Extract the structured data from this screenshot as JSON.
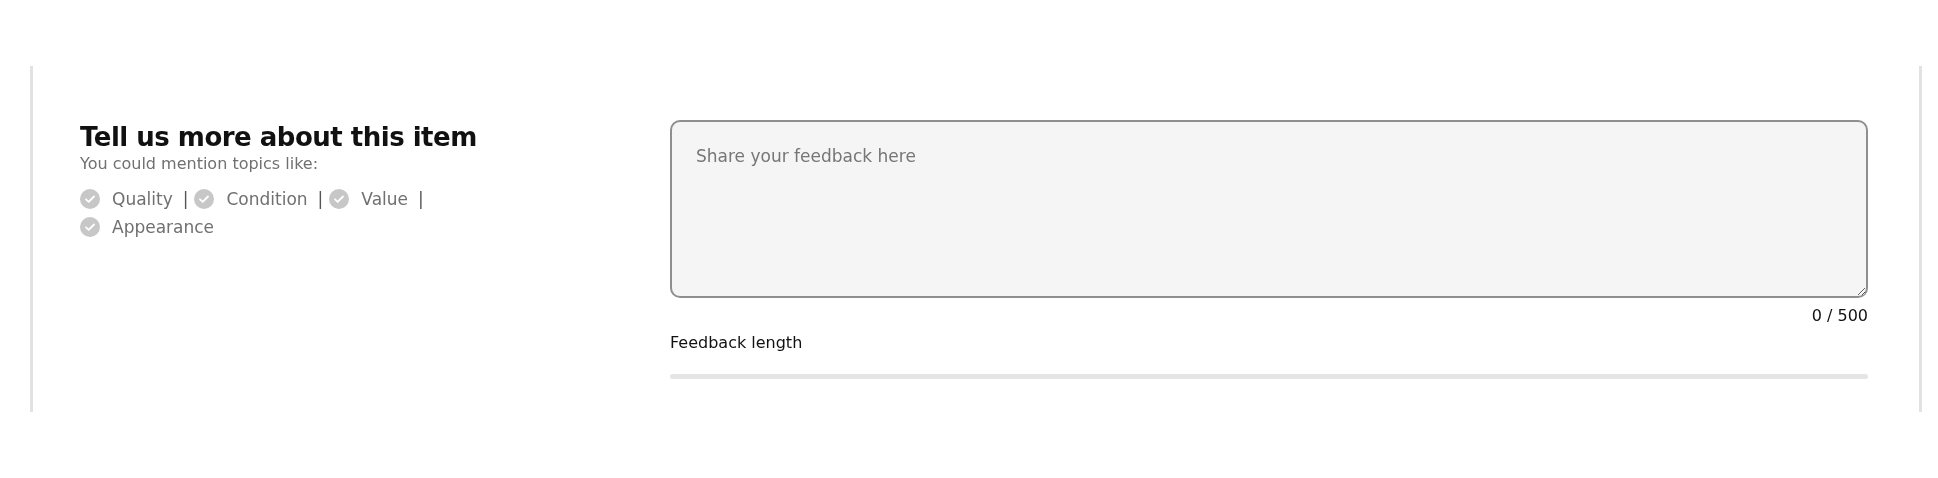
{
  "section": {
    "title": "Tell us more about this item",
    "subtitle": "You could mention topics like:",
    "topics": [
      {
        "label": "Quality",
        "checked": false,
        "separator": "|"
      },
      {
        "label": "Condition",
        "checked": false,
        "separator": "|"
      },
      {
        "label": "Value",
        "checked": false,
        "separator": "|"
      },
      {
        "label": "Appearance",
        "checked": false
      }
    ]
  },
  "feedback": {
    "placeholder": "Share your feedback here",
    "counter": "0 / 500",
    "meter_label": "Feedback length",
    "level": 0
  }
}
